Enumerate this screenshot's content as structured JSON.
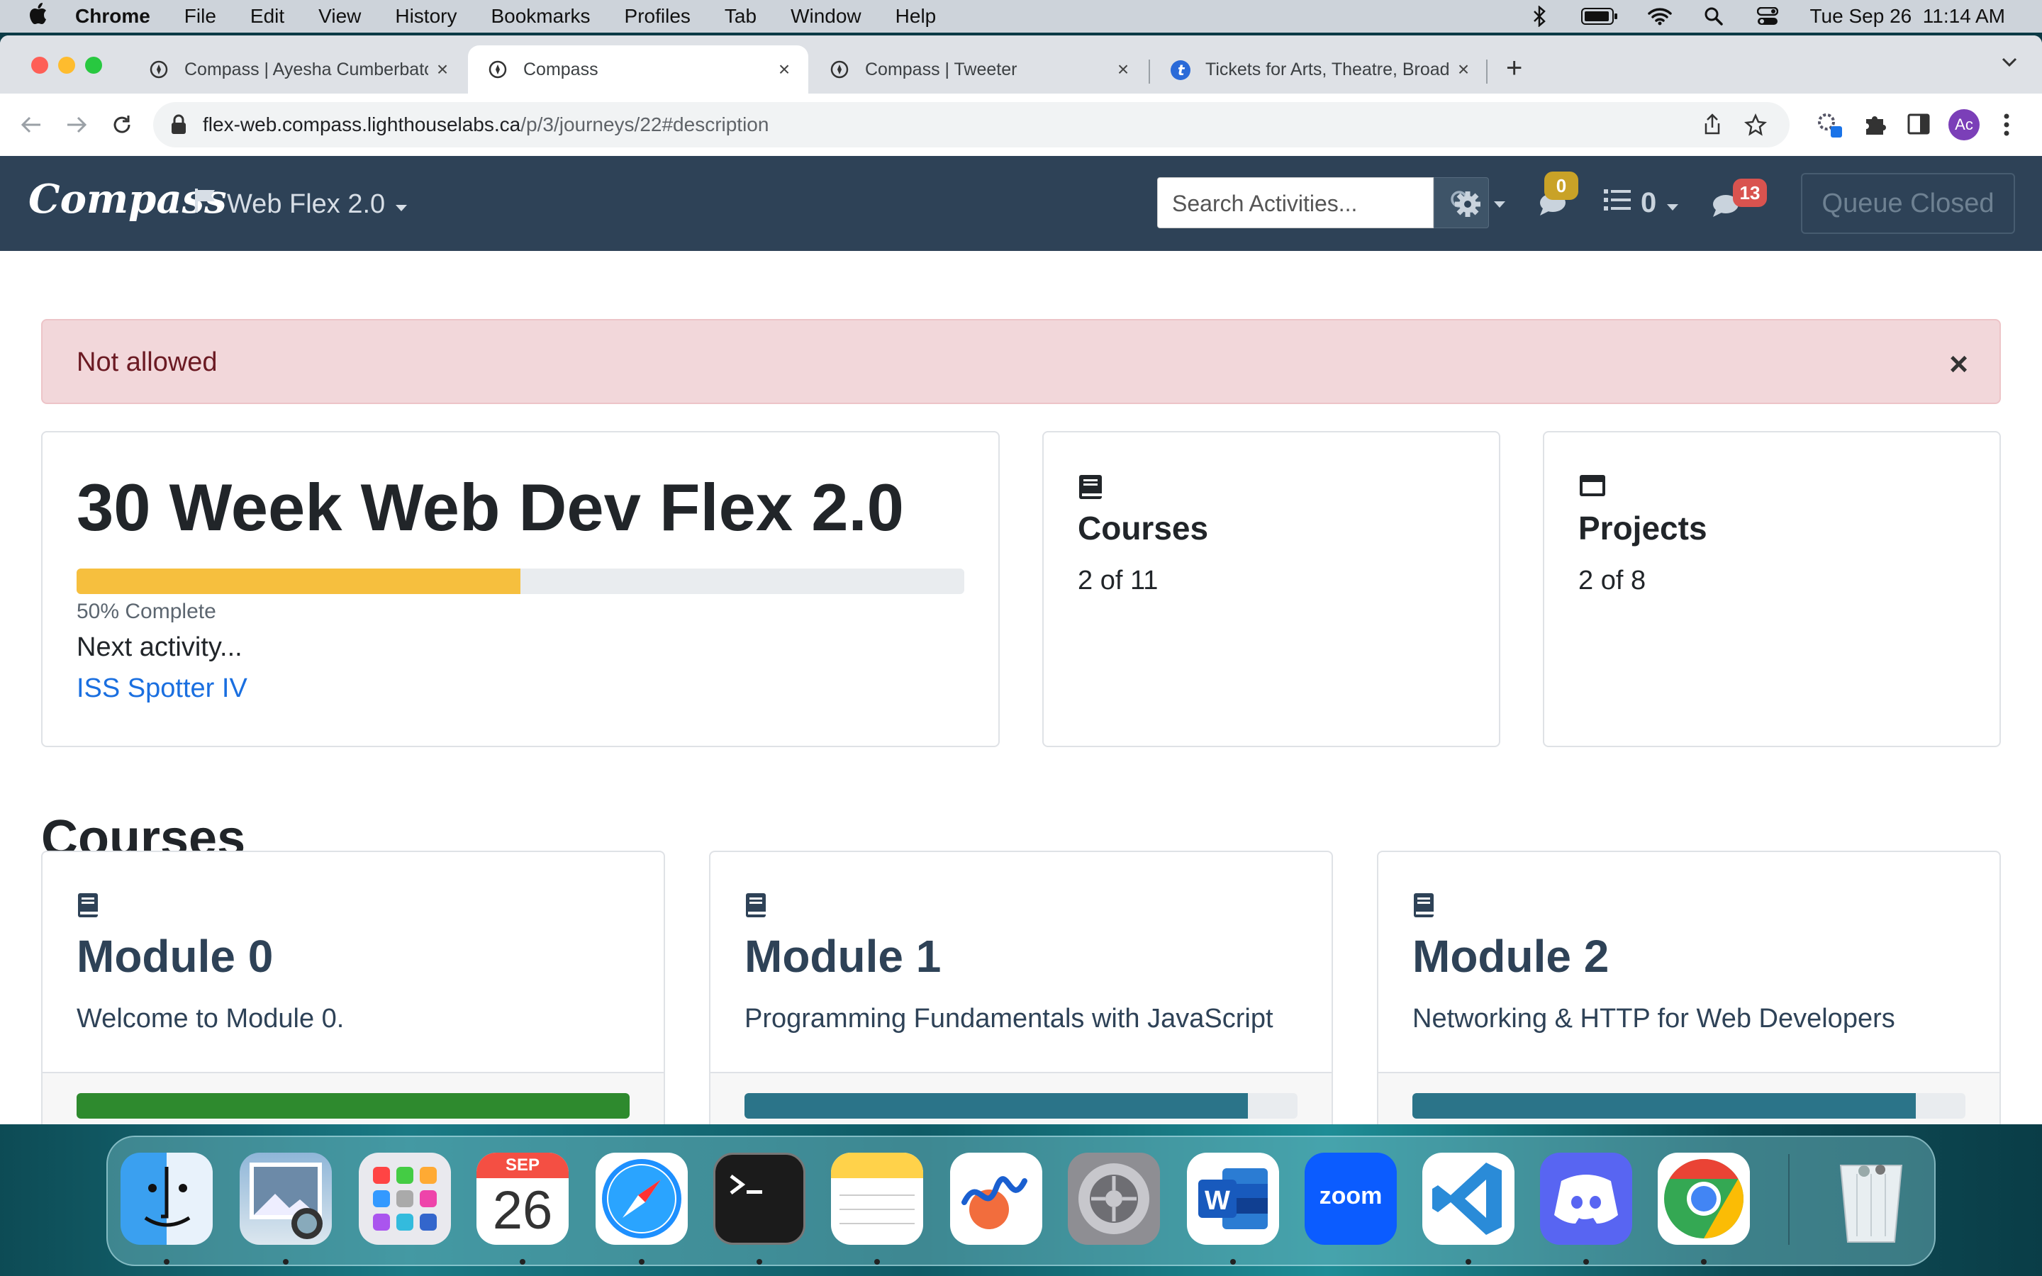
{
  "menubar": {
    "app": "Chrome",
    "items": [
      "File",
      "Edit",
      "View",
      "History",
      "Bookmarks",
      "Profiles",
      "Tab",
      "Window",
      "Help"
    ],
    "datetime": "Tue Sep 26  11:14 AM"
  },
  "browser": {
    "tabs": [
      {
        "title": "Compass | Ayesha Cumberbatch",
        "active": false
      },
      {
        "title": "Compass",
        "active": true
      },
      {
        "title": "Compass | Tweeter",
        "active": false
      },
      {
        "title": "Tickets for Arts, Theatre, Broadway",
        "active": false
      }
    ],
    "url_host": "flex-web.compass.lighthouselabs.ca",
    "url_path": "/p/3/journeys/22#description",
    "profile_initials": "Ac"
  },
  "navbar": {
    "brand": "Compass",
    "journey_label": "Web Flex 2.0",
    "search_placeholder": "Search Activities...",
    "notifications_count": "0",
    "queue_count": "0",
    "messages_count": "13",
    "queue_button": "Queue Closed"
  },
  "alert": {
    "message": "Not allowed",
    "close": "×"
  },
  "journey_card": {
    "title": "30 Week Web Dev Flex 2.0",
    "progress": 0.5,
    "progress_text": "50% Complete",
    "next_label": "Next activity...",
    "next_link": "ISS Spotter IV"
  },
  "stats": {
    "courses": {
      "label": "Courses",
      "count": "2 of 11"
    },
    "projects": {
      "label": "Projects",
      "count": "2 of 8"
    }
  },
  "courses_section": {
    "title": "Courses",
    "modules": [
      {
        "title": "Module 0",
        "description": "Welcome to Module 0.",
        "progress": 1.0
      },
      {
        "title": "Module 1",
        "description": "Programming Fundamentals with JavaScript",
        "progress": 0.91
      },
      {
        "title": "Module 2",
        "description": "Networking & HTTP for Web Developers",
        "progress": 0.91
      }
    ]
  },
  "colors": {
    "navbar": "#2e4257",
    "journey_progress": "#f6bf3e",
    "module0_progress": "#2e8a2e",
    "module_progress": "#2b7489",
    "alert_bg": "#f2d7da",
    "badge_notifications": "#c9a227",
    "badge_messages": "#d9534f"
  },
  "dock": {
    "calendar_month": "SEP",
    "calendar_day": "26",
    "zoom_label": "zoom",
    "apps": [
      "Finder",
      "Preview",
      "Launchpad",
      "Calendar",
      "Safari",
      "Terminal",
      "Notes",
      "Freeform",
      "System Settings",
      "Microsoft Word",
      "Zoom",
      "Visual Studio Code",
      "Discord",
      "Google Chrome",
      "Trash"
    ]
  }
}
